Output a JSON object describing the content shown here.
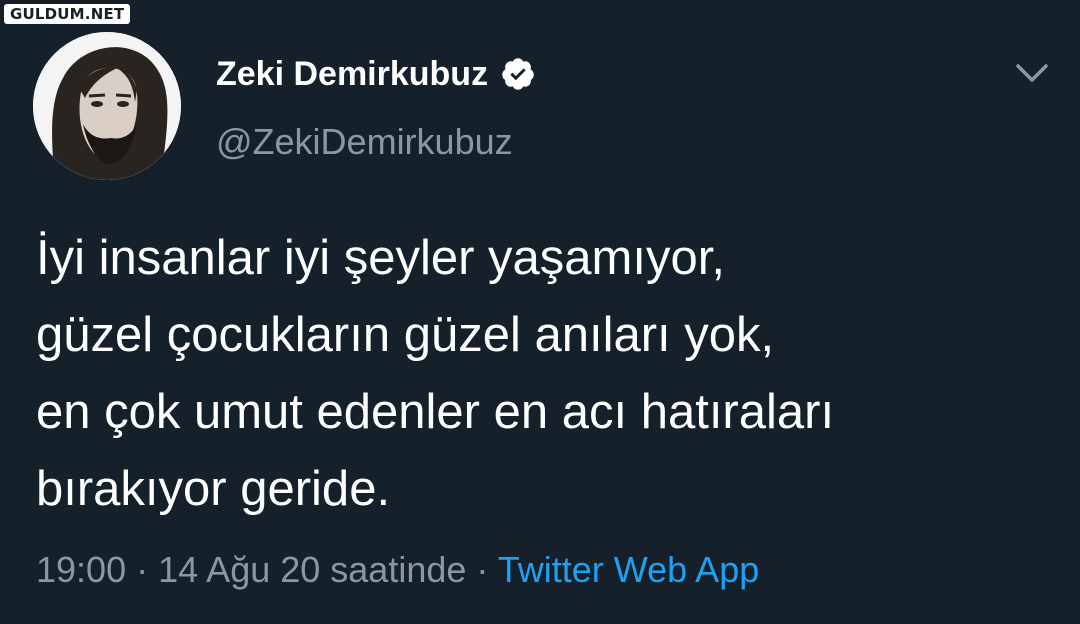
{
  "watermark": "GULDUM.NET",
  "author": {
    "display_name": "Zeki Demirkubuz",
    "handle": "@ZekiDemirkubuz",
    "verified": true
  },
  "tweet": {
    "lines": [
      "İyi insanlar iyi şeyler yaşamıyor,",
      "güzel çocukların güzel anıları yok,",
      "en çok umut edenler en acı hatıraları",
      "bırakıyor geride."
    ],
    "time": "19:00",
    "date": "14 Ağu 20 saatinde",
    "separator": "·",
    "source": "Twitter Web App"
  },
  "icons": {
    "verified": "verified-badge-icon",
    "menu": "chevron-down-icon"
  },
  "colors": {
    "background": "#15202b",
    "text": "#ffffff",
    "secondary": "#8899a6",
    "link": "#1da1f2"
  }
}
